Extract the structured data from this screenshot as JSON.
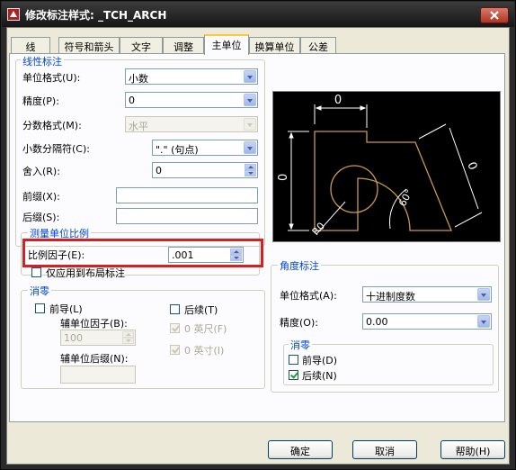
{
  "window": {
    "title": "修改标注样式: _TCH_ARCH"
  },
  "tabs": [
    "线",
    "符号和箭头",
    "文字",
    "调整",
    "主单位",
    "换算单位",
    "公差"
  ],
  "linear": {
    "group_title": "线性标注",
    "unit_format_label": "单位格式(U):",
    "unit_format_value": "小数",
    "precision_label": "精度(P):",
    "precision_value": "0",
    "fraction_format_label": "分数格式(M):",
    "fraction_format_value": "水平",
    "decimal_separator_label": "小数分隔符(C):",
    "decimal_separator_value": "\".\" (句点)",
    "round_off_label": "舍入(R):",
    "round_off_value": "0",
    "prefix_label": "前缀(X):",
    "prefix_value": "",
    "suffix_label": "后缀(S):",
    "suffix_value": ""
  },
  "scale": {
    "group_title": "测量单位比例",
    "scale_factor_label": "比例因子(E):",
    "scale_factor_value": ".001",
    "layout_only_label": "仅应用到布局标注",
    "layout_only_checked": false
  },
  "zero_suppression": {
    "group_title": "消零",
    "leading_label": "前导(L)",
    "leading_checked": false,
    "sub_unit_factor_label": "辅单位因子(B):",
    "sub_unit_factor_value": "100",
    "sub_unit_suffix_label": "辅单位后缀(N):",
    "sub_unit_suffix_value": "",
    "trailing_label": "后续(T)",
    "trailing_checked": false,
    "feet_label": "0 英尺(F)",
    "feet_checked": true,
    "inches_label": "0 英寸(I)",
    "inches_checked": true
  },
  "angular": {
    "group_title": "角度标注",
    "unit_format_label": "单位格式(A):",
    "unit_format_value": "十进制度数",
    "precision_label": "精度(O):",
    "precision_value": "0.00",
    "zero_group_title": "消零",
    "leading_label": "前导(D)",
    "leading_checked": false,
    "trailing_label": "后续(N)",
    "trailing_checked": true
  },
  "preview": {
    "dim_top": "0",
    "dim_left": "0",
    "dim_diag": "0",
    "dim_angle": "60°",
    "dim_radius": "R0",
    "colors": {
      "shape": "#c89a52",
      "dims": "#ffffff",
      "background": "#000000"
    }
  },
  "buttons": {
    "ok": "确定",
    "cancel": "取消",
    "help": "帮助(H)"
  }
}
